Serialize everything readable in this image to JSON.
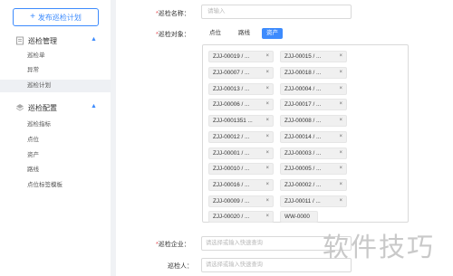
{
  "sidebar": {
    "publish_button": "发布巡检计划",
    "groups": [
      {
        "label": "巡检管理",
        "icon": "document-icon",
        "items": [
          "巡检单",
          "异常",
          "巡检计划"
        ],
        "active": "巡检计划"
      },
      {
        "label": "巡检配置",
        "icon": "layers-icon",
        "items": [
          "巡检指标",
          "点位",
          "资产",
          "路线",
          "点位标签模板"
        ]
      }
    ]
  },
  "form": {
    "name_label": "巡检名称：",
    "name_placeholder": "请输入",
    "object_label": "巡检对象：",
    "object_options": [
      "点位",
      "路线",
      "资产"
    ],
    "object_selected": "资产",
    "tags": [
      "ZJJ-00019 / ...",
      "ZJJ-00015 / ...",
      "ZJJ-00007 / ...",
      "ZJJ-00018 / ...",
      "ZJJ-00013 / ...",
      "ZJJ-00004 / ...",
      "ZJJ-00006 / ...",
      "ZJJ-00017 / ...",
      "ZJJ-0001351 ...",
      "ZJJ-00008 / ...",
      "ZJJ-00012 / ...",
      "ZJJ-00014 / ...",
      "ZJJ-00001 / ...",
      "ZJJ-00003 / ...",
      "ZJJ-00010 / ...",
      "ZJJ-00005 / ...",
      "ZJJ-00016 / ...",
      "ZJJ-00002 / ...",
      "ZJJ-00009 / ...",
      "ZJJ-00011 / ...",
      "ZJJ-00020 / ...",
      "WW-0000"
    ],
    "company_label": "巡检企业：",
    "company_placeholder": "请选择或输入快速查询",
    "person_label": "巡检人：",
    "person_placeholder": "请选择或输入快速查询"
  },
  "watermark": "软件技巧",
  "colors": {
    "accent": "#3d8bfd",
    "required": "#e5484d"
  }
}
